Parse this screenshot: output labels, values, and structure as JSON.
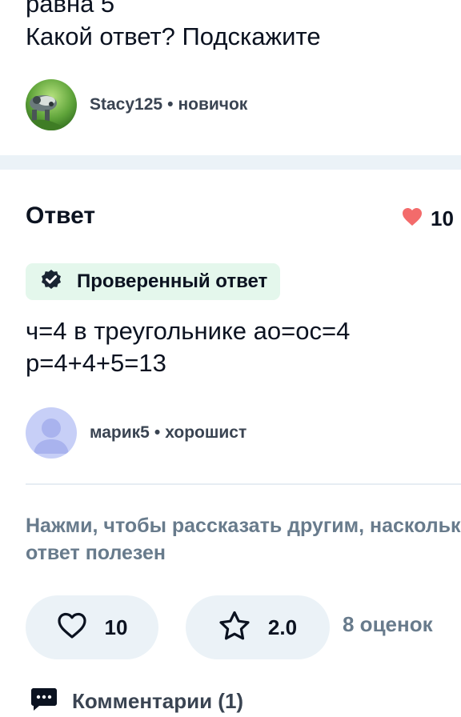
{
  "question": {
    "lines": [
      "равна 5",
      "Какой ответ? Подскажите"
    ]
  },
  "asker": {
    "name": "Stacy125",
    "separator": "•",
    "rank": "новичок",
    "avatar_icon": "avatar-photo"
  },
  "answer": {
    "heading": "Ответ",
    "likes": "10",
    "verified_label": "Проверенный ответ",
    "body_lines": [
      "ч=4 в треугольнике ао=ос=4",
      "р=4+4+5=13"
    ]
  },
  "answerer": {
    "name": "марик5",
    "separator": "•",
    "rank": "хорошист",
    "avatar_icon": "default-avatar"
  },
  "feedback": {
    "prompt_lines": [
      "Нажми, чтобы рассказать другим, насколько",
      "ответ полезен"
    ],
    "like_count": "10",
    "rating": "2.0",
    "rating_count": "8 оценок"
  },
  "comments": {
    "label": "Комментарии (1)"
  },
  "colors": {
    "heart_red": "#f36b6b",
    "verified_bg": "#e4f7ec",
    "separator_bg": "#ebf2f7",
    "muted_text": "#687b8c"
  }
}
